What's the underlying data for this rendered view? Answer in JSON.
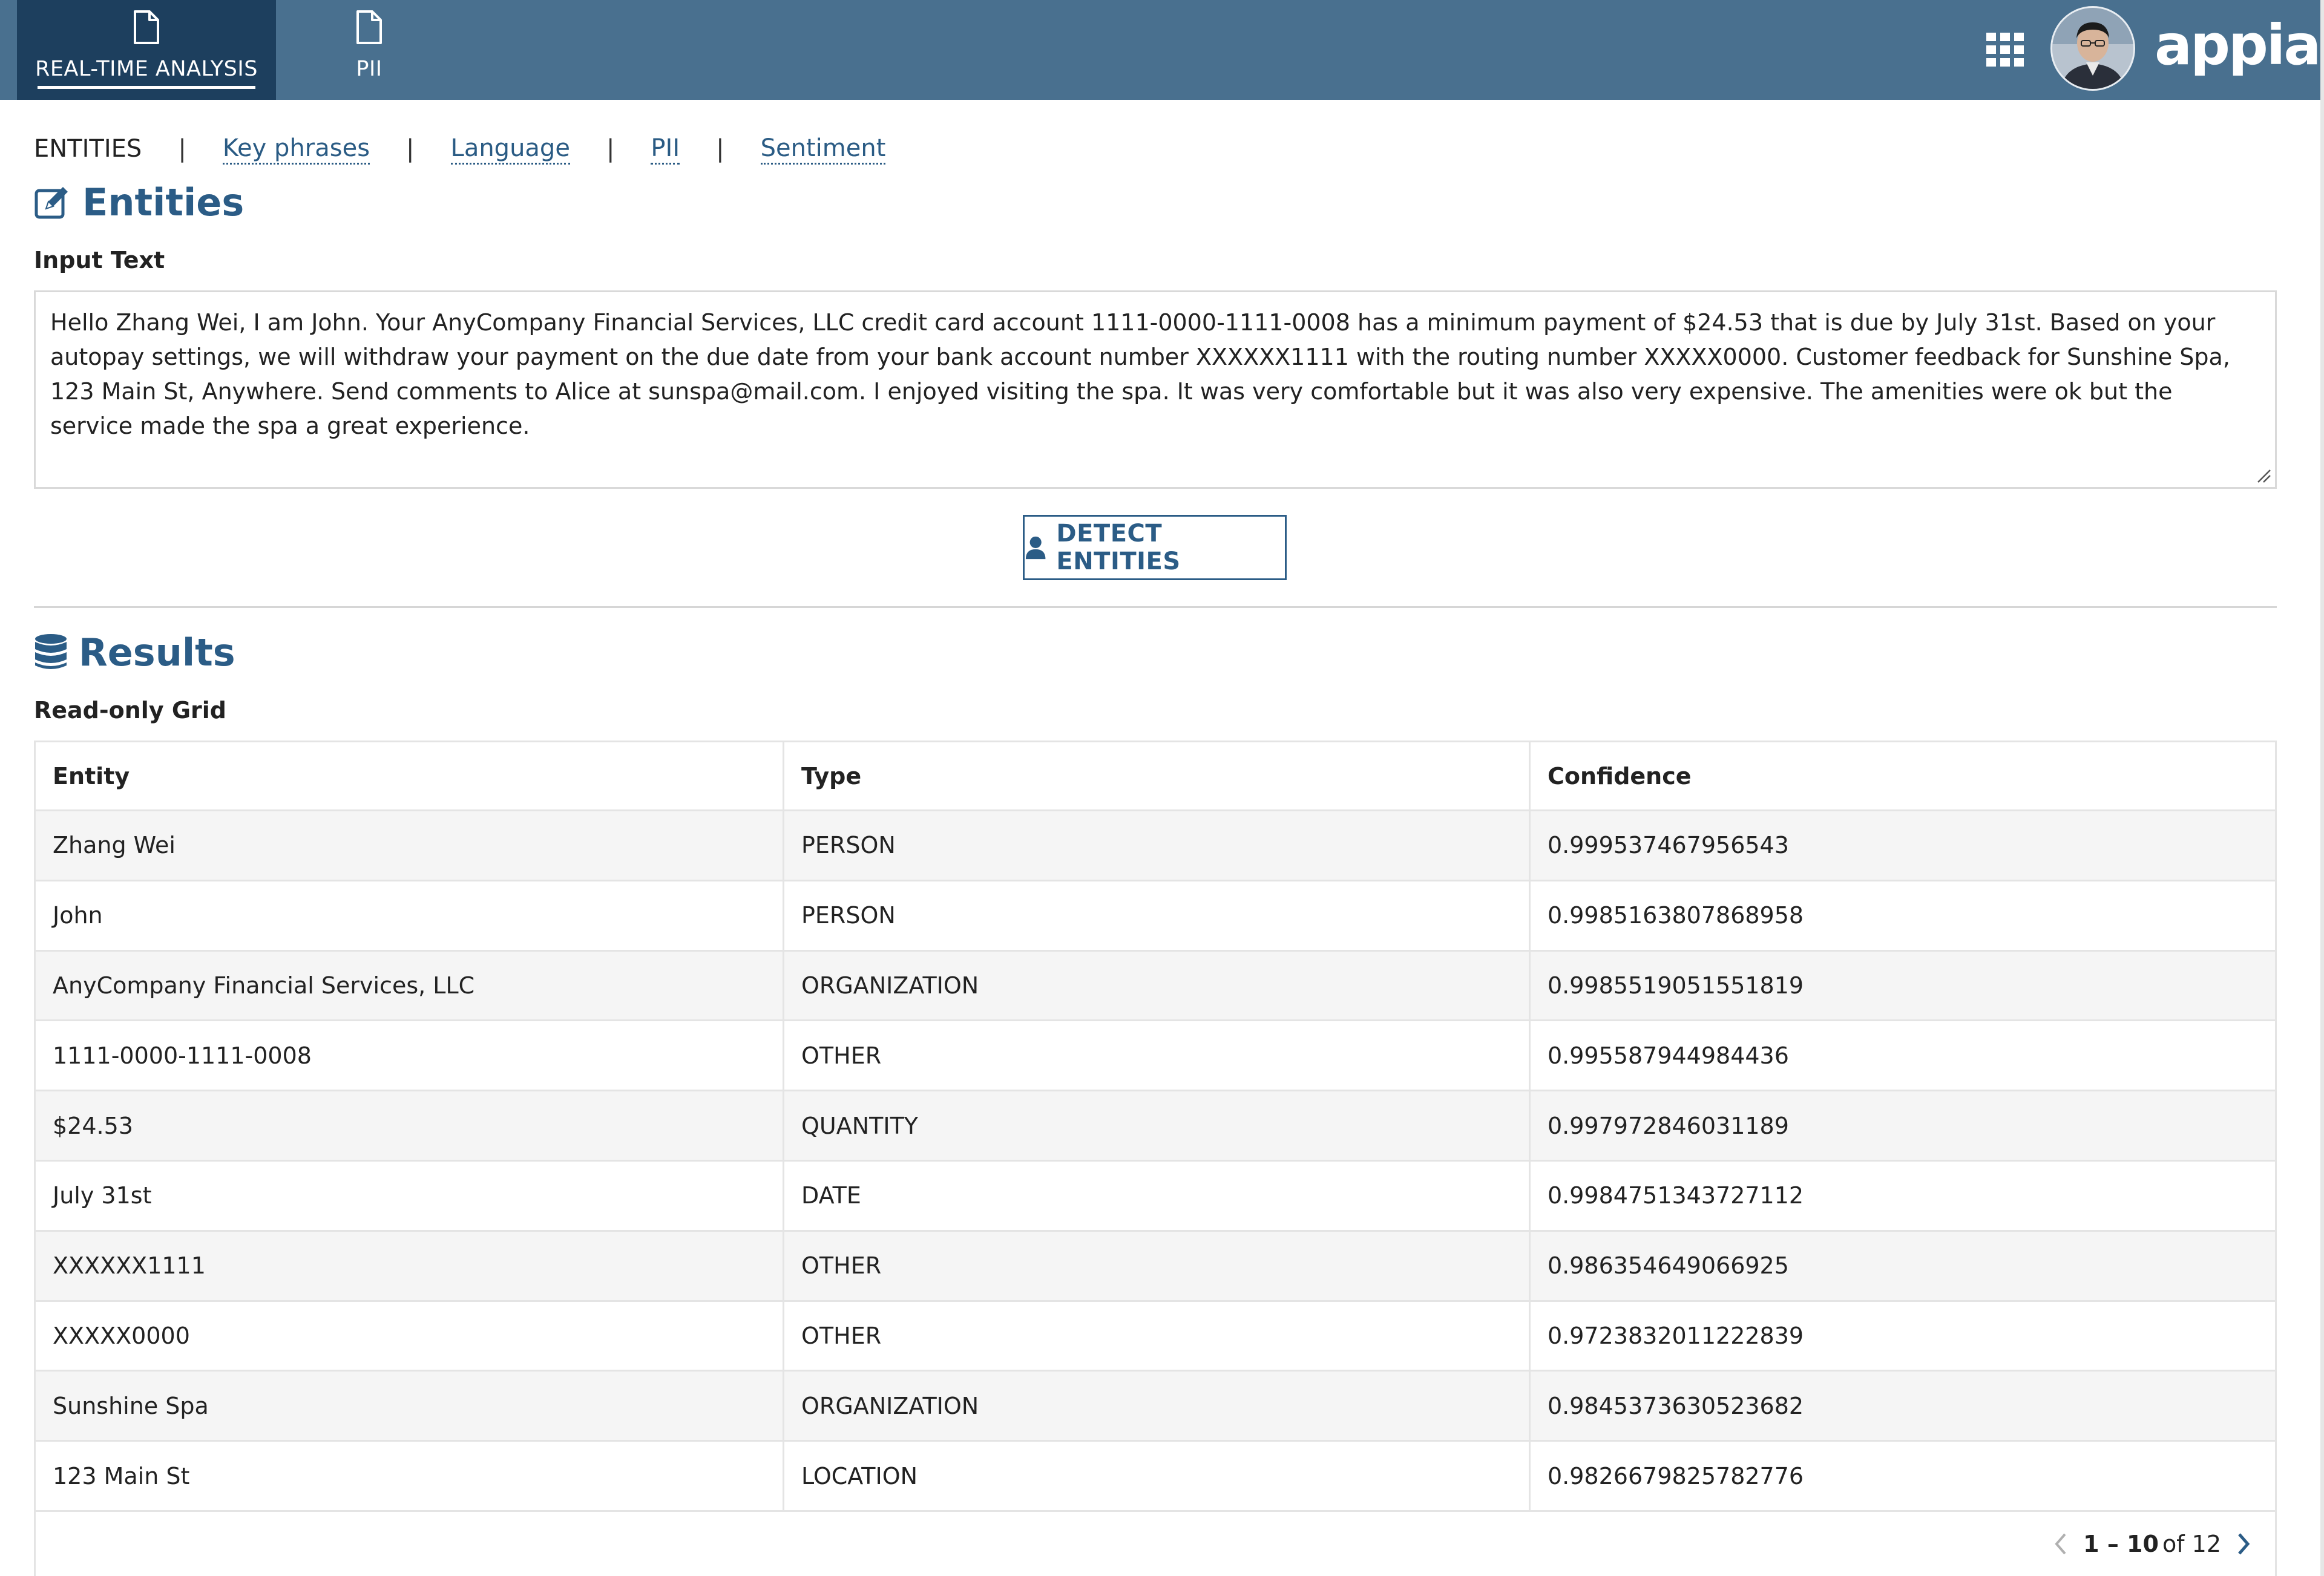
{
  "header": {
    "tabs": [
      {
        "label": "REAL-TIME ANALYSIS",
        "icon": "document-icon",
        "active": true
      },
      {
        "label": "PII",
        "icon": "document-icon",
        "active": false
      }
    ],
    "apps_icon": "grid-icon",
    "logo_text": "appian",
    "colors": {
      "header_bg": "#49708f",
      "active_tab_bg": "#1d3f5e"
    }
  },
  "subnav": {
    "current": "ENTITIES",
    "separator": "|",
    "links": [
      "Key phrases",
      "Language",
      "PII",
      "Sentiment"
    ]
  },
  "entities_section": {
    "title": "Entities",
    "icon": "edit-icon",
    "input_label": "Input Text",
    "input_text": "Hello Zhang Wei, I am John. Your AnyCompany Financial Services, LLC credit card account 1111-0000-1111-0008 has a minimum payment of $24.53 that is due by July 31st. Based on your autopay settings, we will withdraw your payment on the due date from your bank account number XXXXXX1111 with the routing number XXXXX0000.  Customer feedback for Sunshine Spa, 123 Main St, Anywhere. Send comments to Alice at sunspa@mail.com.  I enjoyed visiting the spa. It was very comfortable but it was also very expensive. The amenities were ok but the service made the spa a great experience.",
    "detect_button_label": "DETECT ENTITIES",
    "detect_button_icon": "user-icon",
    "accent_color": "#2b5c86"
  },
  "results_section": {
    "title": "Results",
    "icon": "database-icon",
    "grid_label": "Read-only Grid",
    "columns": [
      "Entity",
      "Type",
      "Confidence"
    ],
    "rows": [
      {
        "entity": "Zhang Wei",
        "type": "PERSON",
        "confidence": "0.999537467956543"
      },
      {
        "entity": "John",
        "type": "PERSON",
        "confidence": "0.9985163807868958"
      },
      {
        "entity": "AnyCompany Financial Services, LLC",
        "type": "ORGANIZATION",
        "confidence": "0.9985519051551819"
      },
      {
        "entity": "1111-0000-1111-0008",
        "type": "OTHER",
        "confidence": "0.995587944984436"
      },
      {
        "entity": "$24.53",
        "type": "QUANTITY",
        "confidence": "0.997972846031189"
      },
      {
        "entity": "July 31st",
        "type": "DATE",
        "confidence": "0.9984751343727112"
      },
      {
        "entity": "XXXXXX1111",
        "type": "OTHER",
        "confidence": "0.986354649066925"
      },
      {
        "entity": "XXXXX0000",
        "type": "OTHER",
        "confidence": "0.9723832011222839"
      },
      {
        "entity": "Sunshine Spa",
        "type": "ORGANIZATION",
        "confidence": "0.9845373630523682"
      },
      {
        "entity": "123 Main St",
        "type": "LOCATION",
        "confidence": "0.9826679825782776"
      }
    ],
    "pager": {
      "range": "1 – 10",
      "of_label": "of 12"
    }
  }
}
